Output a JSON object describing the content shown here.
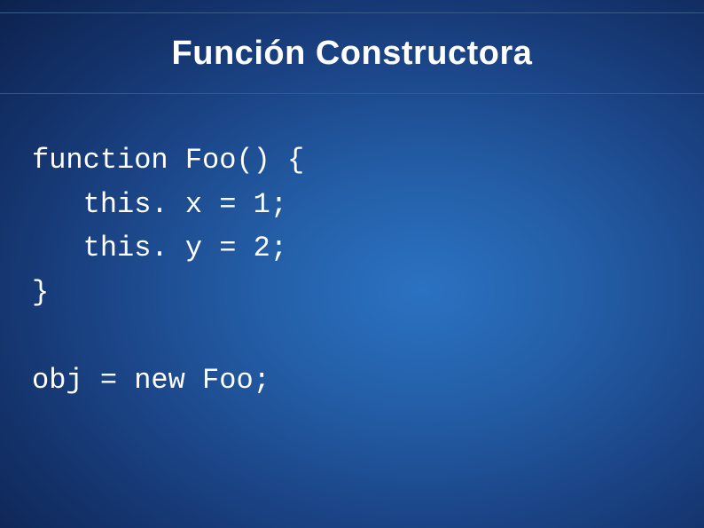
{
  "slide": {
    "title": "Función Constructora",
    "code": {
      "line1": "function Foo() {",
      "line2": "   this. x = 1;",
      "line3": "   this. y = 2;",
      "line4": "}",
      "line5": "",
      "line6": "obj = new Foo;"
    }
  }
}
